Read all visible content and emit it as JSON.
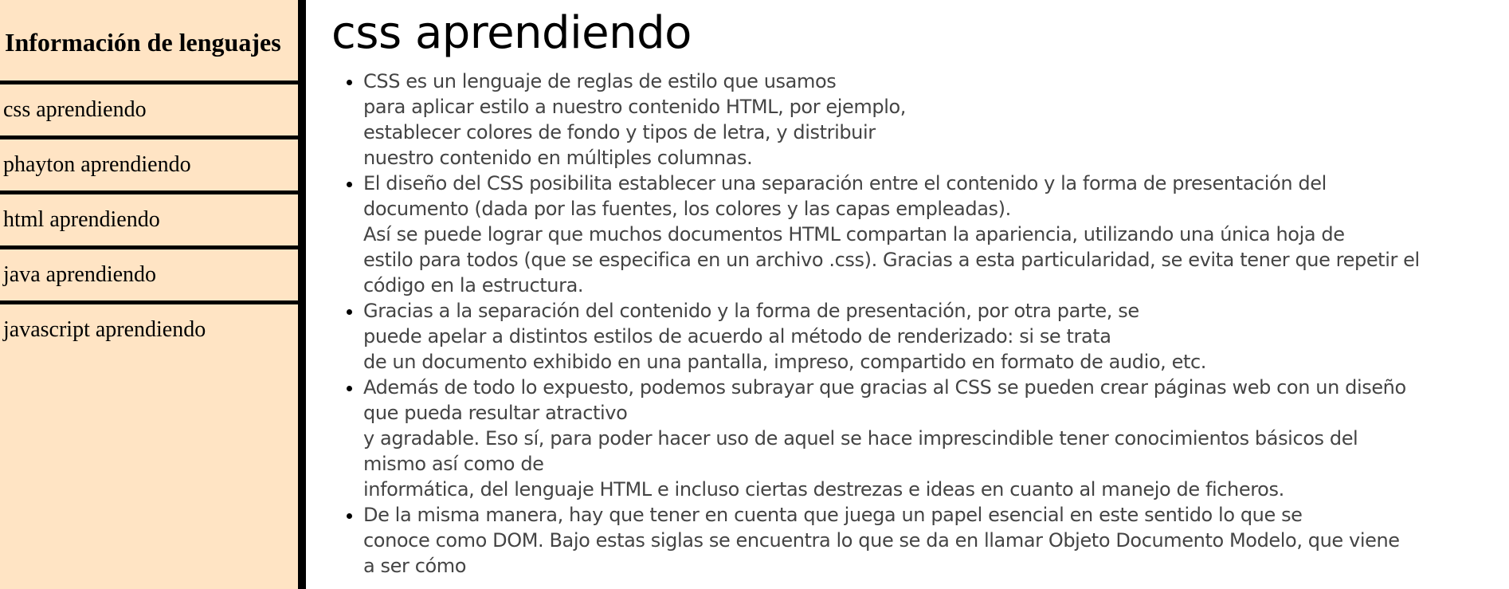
{
  "sidebar": {
    "title": "Información de lenguajes",
    "items": [
      {
        "label": "css aprendiendo"
      },
      {
        "label": "phayton aprendiendo"
      },
      {
        "label": "html aprendiendo"
      },
      {
        "label": "java aprendiendo"
      },
      {
        "label": "javascript aprendiendo"
      }
    ]
  },
  "main": {
    "title": "css aprendiendo",
    "paragraphs": [
      {
        "lines": [
          "CSS es un lenguaje de reglas de estilo que usamos",
          "para aplicar estilo a nuestro contenido HTML, por ejemplo,",
          "establecer colores de fondo y tipos de letra, y distribuir",
          "nuestro contenido en múltiples columnas."
        ]
      },
      {
        "lines": [
          "El diseño del CSS posibilita establecer una separación entre el contenido y la forma de presentación del",
          "documento (dada por las fuentes, los colores y las capas empleadas).",
          "Así se puede lograr que muchos documentos HTML compartan la apariencia, utilizando una única hoja de",
          "estilo para todos (que se especifica en un archivo .css). Gracias a esta particularidad, se evita tener que repetir el",
          "código en la estructura."
        ]
      },
      {
        "lines": [
          "Gracias a la separación del contenido y la forma de presentación, por otra parte, se",
          "puede apelar a distintos estilos de acuerdo al método de renderizado: si se trata",
          "de un documento exhibido en una pantalla, impreso, compartido en formato de audio, etc."
        ]
      },
      {
        "lines": [
          "Además de todo lo expuesto, podemos subrayar que gracias al CSS se pueden crear páginas web con un diseño",
          "que pueda resultar atractivo",
          "y agradable. Eso sí, para poder hacer uso de aquel se hace imprescindible tener conocimientos básicos del",
          "mismo así como de",
          "informática, del lenguaje HTML e incluso ciertas destrezas e ideas en cuanto al manejo de ficheros."
        ]
      },
      {
        "lines": [
          "De la misma manera, hay que tener en cuenta que juega un papel esencial en este sentido lo que se",
          "conoce como DOM. Bajo estas siglas se encuentra lo que se da en llamar Objeto Documento Modelo, que viene",
          "a ser cómo"
        ]
      }
    ]
  },
  "colors": {
    "sidebar_background": "#ffe4c4",
    "border": "#000000",
    "body_text": "#444444"
  }
}
